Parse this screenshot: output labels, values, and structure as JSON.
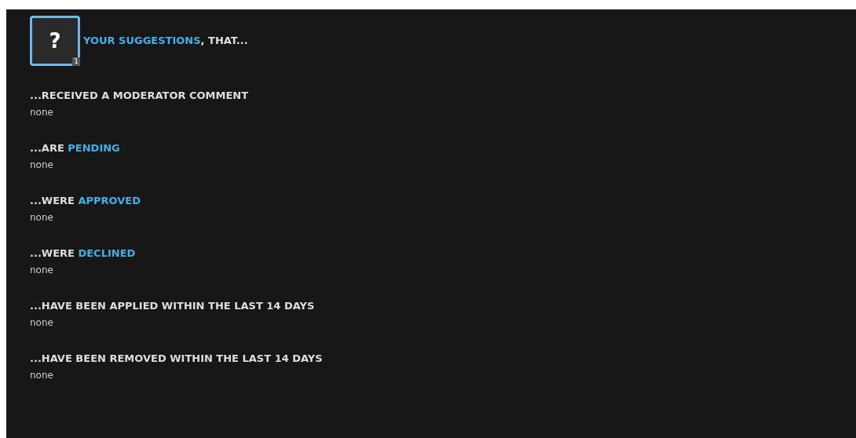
{
  "header": {
    "badge": "1",
    "glyph": "?",
    "link": "YOUR SUGGESTIONS",
    "rest": ", THAT..."
  },
  "sections": [
    {
      "prefix": "...RECEIVED A MODERATOR COMMENT",
      "value": "none"
    },
    {
      "prefix": "...ARE ",
      "link": "PENDING",
      "value": "none"
    },
    {
      "prefix": "...WERE ",
      "link": "APPROVED",
      "value": "none"
    },
    {
      "prefix": "...WERE ",
      "link": "DECLINED",
      "value": "none"
    },
    {
      "prefix": "...HAVE BEEN APPLIED WITHIN THE LAST 14 DAYS",
      "value": "none"
    },
    {
      "prefix": "...HAVE BEEN REMOVED WITHIN THE LAST 14 DAYS",
      "value": "none"
    }
  ]
}
